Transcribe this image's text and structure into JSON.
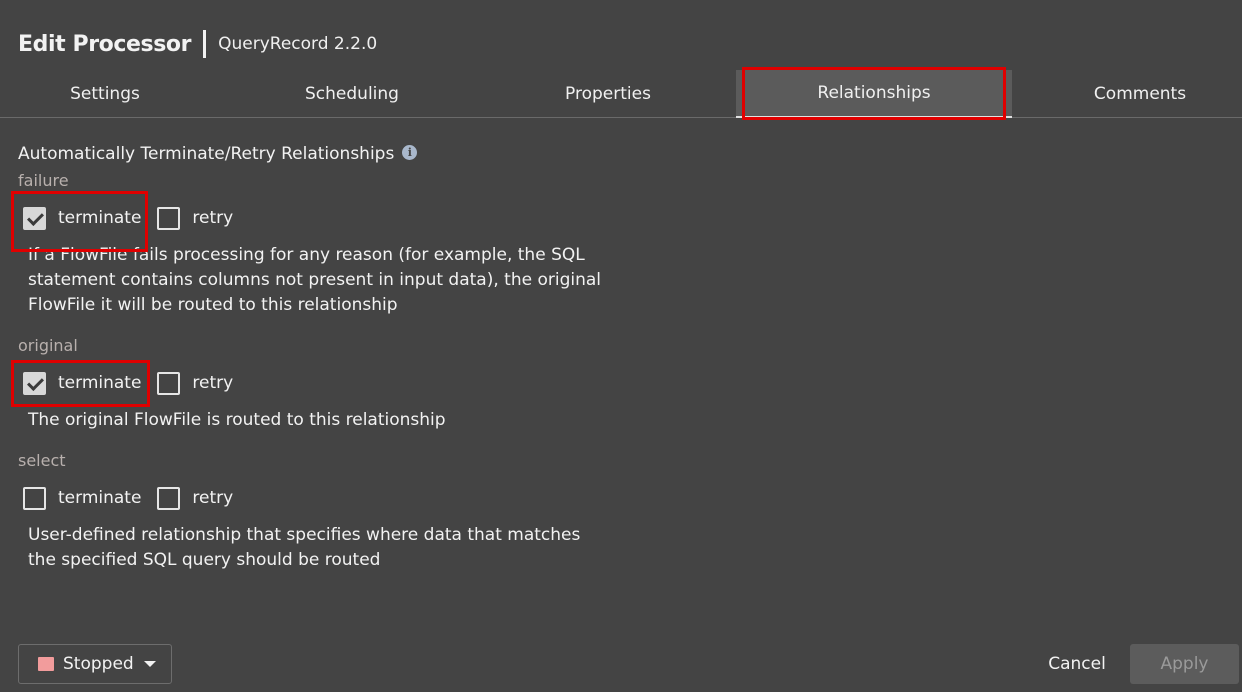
{
  "header": {
    "title": "Edit Processor",
    "subtitle": "QueryRecord 2.2.0"
  },
  "tabs": [
    {
      "label": "Settings",
      "active": false
    },
    {
      "label": "Scheduling",
      "active": false
    },
    {
      "label": "Properties",
      "active": false
    },
    {
      "label": "Relationships",
      "active": true
    },
    {
      "label": "Comments",
      "active": false
    }
  ],
  "section": {
    "title": "Automatically Terminate/Retry Relationships",
    "info_icon": "info-icon"
  },
  "relationships": [
    {
      "name": "failure",
      "terminate_label": "terminate",
      "terminate_checked": true,
      "retry_label": "retry",
      "retry_checked": false,
      "description_lines": [
        "If a FlowFile fails processing for any reason (for example, the SQL",
        "statement contains columns not present in input data), the original",
        "FlowFile it will be routed to this relationship"
      ]
    },
    {
      "name": "original",
      "terminate_label": "terminate",
      "terminate_checked": true,
      "retry_label": "retry",
      "retry_checked": false,
      "description_lines": [
        "The original FlowFile is routed to this relationship"
      ]
    },
    {
      "name": "select",
      "terminate_label": "terminate",
      "terminate_checked": false,
      "retry_label": "retry",
      "retry_checked": false,
      "description_lines": [
        "User-defined relationship that specifies where data that matches",
        "the specified SQL query should be routed"
      ]
    }
  ],
  "footer": {
    "status_label": "Stopped",
    "status_color": "#f29c9c",
    "cancel_label": "Cancel",
    "apply_label": "Apply"
  },
  "colors": {
    "highlight": "#e00000",
    "background": "#444444"
  }
}
